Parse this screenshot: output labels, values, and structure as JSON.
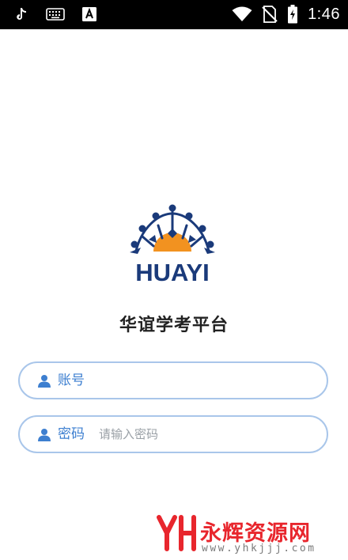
{
  "status_bar": {
    "time": "1:46",
    "left_icons": [
      "tiktok-icon",
      "keyboard-icon",
      "font-a-icon"
    ],
    "right_icons": [
      "wifi-icon",
      "no-sim-icon",
      "battery-charging-icon"
    ]
  },
  "logo": {
    "text": "HUAYI",
    "colors": {
      "navy": "#1a3a7a",
      "sun": "#f29220"
    }
  },
  "app_title": "华谊学考平台",
  "form": {
    "account": {
      "label": "账号",
      "value": "",
      "placeholder": ""
    },
    "password": {
      "label": "密码",
      "value": "",
      "placeholder": "请输入密码"
    }
  },
  "watermark": {
    "text": "永辉资源网",
    "url": "www.yhkjjj.com"
  },
  "colors": {
    "accent": "#3d7fd0",
    "field_border": "#a9c6ea",
    "watermark_red": "#e8262d"
  }
}
